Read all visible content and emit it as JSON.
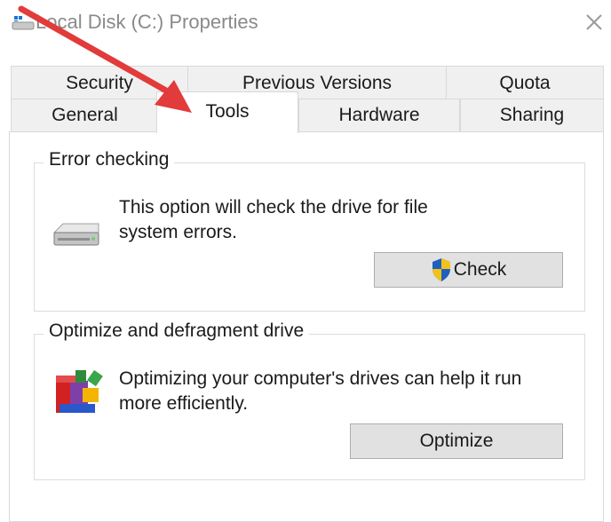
{
  "window": {
    "title": "Local Disk (C:) Properties",
    "title_icon": "drive-icon",
    "close_icon": "close-icon"
  },
  "tabs": {
    "row1": [
      {
        "label": "Security"
      },
      {
        "label": "Previous Versions"
      },
      {
        "label": "Quota"
      }
    ],
    "row2": [
      {
        "label": "General"
      },
      {
        "label": "Tools",
        "active": true
      },
      {
        "label": "Hardware"
      },
      {
        "label": "Sharing"
      }
    ]
  },
  "error_checking": {
    "legend": "Error checking",
    "desc_line1": "This option will check the drive for file",
    "desc_line2": "system errors.",
    "icon": "hard-drive-icon",
    "button_label": "Check",
    "button_icon": "uac-shield-icon"
  },
  "optimize": {
    "legend": "Optimize and defragment drive",
    "desc_line1": "Optimizing your computer's drives can help it run",
    "desc_line2": "more efficiently.",
    "icon": "defrag-icon",
    "button_label": "Optimize"
  },
  "annotation": {
    "arrow_color": "#e23b3b",
    "points_to": "Tools"
  },
  "colors": {
    "border": "#d9d9d9",
    "tab_bg": "#f0f0f0",
    "button_bg": "#e1e1e1",
    "title_text": "#8a8a8a"
  }
}
